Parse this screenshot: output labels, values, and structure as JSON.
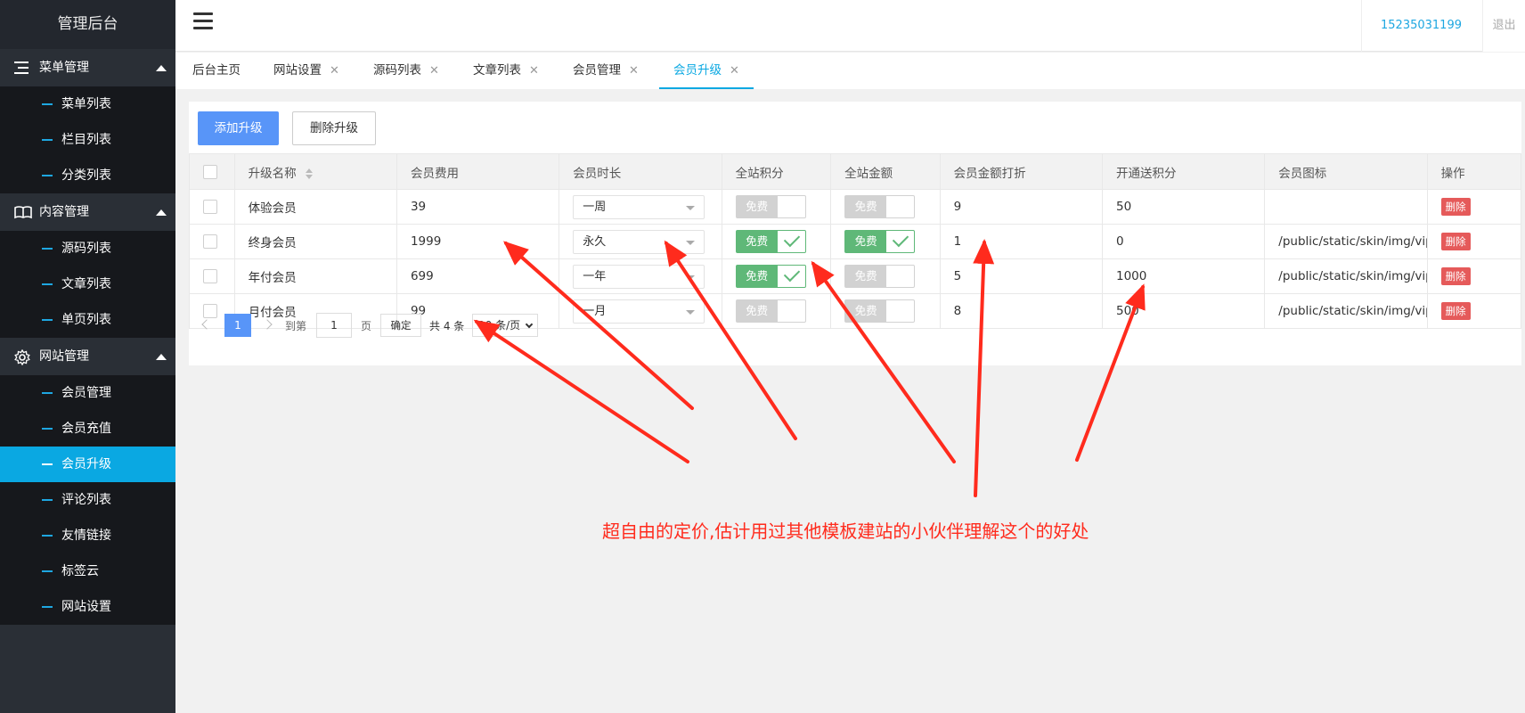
{
  "app": {
    "title": "管理后台"
  },
  "sidebar": {
    "groups": [
      {
        "label": "菜单管理",
        "icon": "menu-list-icon",
        "items": [
          {
            "label": "菜单列表"
          },
          {
            "label": "栏目列表"
          },
          {
            "label": "分类列表"
          }
        ]
      },
      {
        "label": "内容管理",
        "icon": "book-icon",
        "items": [
          {
            "label": "源码列表"
          },
          {
            "label": "文章列表"
          },
          {
            "label": "单页列表"
          }
        ]
      },
      {
        "label": "网站管理",
        "icon": "gear-icon",
        "items": [
          {
            "label": "会员管理"
          },
          {
            "label": "会员充值"
          },
          {
            "label": "会员升级",
            "active": true
          },
          {
            "label": "评论列表"
          },
          {
            "label": "友情链接"
          },
          {
            "label": "标签云"
          },
          {
            "label": "网站设置"
          }
        ]
      }
    ]
  },
  "header": {
    "phone": "15235031199",
    "logout": "退出"
  },
  "tabs": [
    {
      "label": "后台主页",
      "closable": false
    },
    {
      "label": "网站设置",
      "closable": true
    },
    {
      "label": "源码列表",
      "closable": true
    },
    {
      "label": "文章列表",
      "closable": true
    },
    {
      "label": "会员管理",
      "closable": true
    },
    {
      "label": "会员升级",
      "closable": true,
      "active": true
    }
  ],
  "tab_close_glyph": "✕",
  "toolbar": {
    "add_label": "添加升级",
    "delete_label": "删除升级"
  },
  "table": {
    "headers": [
      "升级名称",
      "会员费用",
      "会员时长",
      "全站积分",
      "全站金额",
      "会员金额打折",
      "开通送积分",
      "会员图标",
      "操作"
    ],
    "switch_label": "免费",
    "delete_label": "删除",
    "rows": [
      {
        "name": "体验会员",
        "fee": "39",
        "duration": "一周",
        "points_free": false,
        "amount_free": false,
        "discount": "9",
        "bonus_points": "50",
        "icon_path": ""
      },
      {
        "name": "终身会员",
        "fee": "1999",
        "duration": "永久",
        "points_free": true,
        "amount_free": true,
        "discount": "1",
        "bonus_points": "0",
        "icon_path": "/public/static/skin/img/vip3.png"
      },
      {
        "name": "年付会员",
        "fee": "699",
        "duration": "一年",
        "points_free": true,
        "amount_free": false,
        "discount": "5",
        "bonus_points": "1000",
        "icon_path": "/public/static/skin/img/vip2.png"
      },
      {
        "name": "月付会员",
        "fee": "99",
        "duration": "一月",
        "points_free": false,
        "amount_free": false,
        "discount": "8",
        "bonus_points": "500",
        "icon_path": "/public/static/skin/img/vip1.png"
      }
    ]
  },
  "pagination": {
    "current_page": "1",
    "goto_label": "到第",
    "goto_value": "1",
    "page_label": "页",
    "confirm_label": "确定",
    "total_label": "共 4 条",
    "per_page": "10 条/页"
  },
  "annotation": {
    "text": "超自由的定价,估计用过其他模板建站的小伙伴理解这个的好处",
    "color": "#ff2b1d"
  }
}
